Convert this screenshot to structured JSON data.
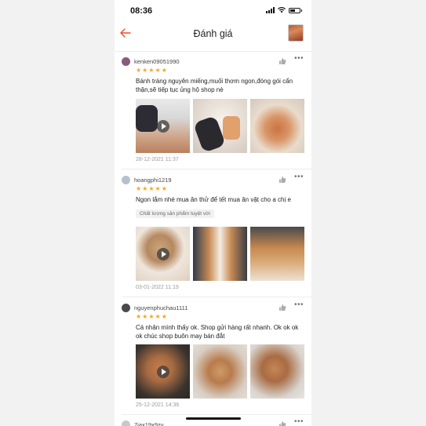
{
  "status": {
    "time": "08:36"
  },
  "header": {
    "title": "Đánh giá"
  },
  "reviews": [
    {
      "username": "kenken09051990",
      "rating": 5,
      "content": "Bánh tráng nguyên miếng,muối thơm ngon,đóng gói cẩn thận,sẽ tiếp tục ủng hộ shop nè",
      "tag": "",
      "date": "28-12-2021 11:37",
      "avatar_color": "#8a5a7a"
    },
    {
      "username": "hoangphi1219",
      "rating": 5,
      "content": "Ngon lắm nhé mua ăn thử để tết mua ăn vặt cho a chị e",
      "tag": "Chất lượng sản phẩm tuyệt vời",
      "date": "03-01-2022 11:19",
      "avatar_color": "#b8c0cc"
    },
    {
      "username": "nguyenphuchau1111",
      "rating": 5,
      "content": "Cá nhân mình thấy ok. Shop gửi hàng rất nhanh. Ok ok ok ok chúc shop buôn may bán đắt",
      "tag": "",
      "date": "25-12-2021 14:36",
      "avatar_color": "#4a4a4a"
    },
    {
      "username": "7iax19x9zv",
      "avatar_color": "#c8c8c8"
    }
  ],
  "colors": {
    "star": "#f5a623",
    "accent": "#ee4d2d"
  }
}
